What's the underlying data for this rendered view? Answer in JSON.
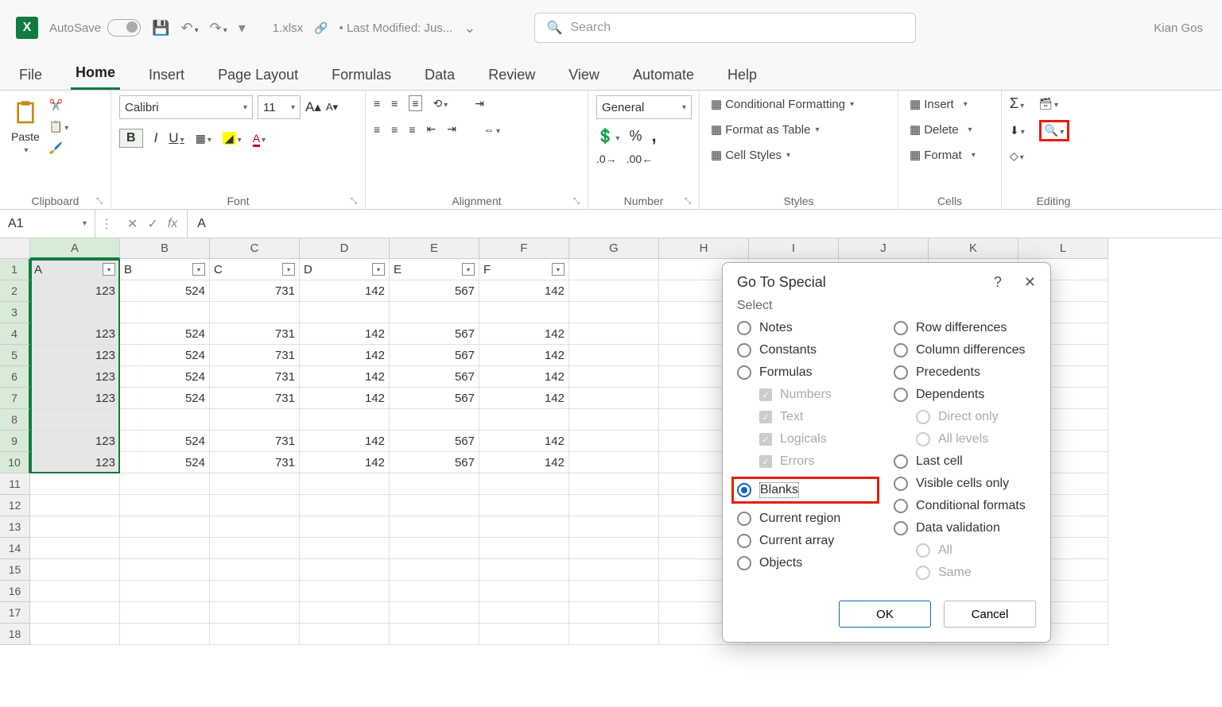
{
  "titlebar": {
    "autosave_label": "AutoSave",
    "autosave_state": "Off",
    "filename": "1.xlsx",
    "modified": "• Last Modified: Jus...",
    "search_placeholder": "Search",
    "username": "Kian Gos"
  },
  "tabs": [
    "File",
    "Home",
    "Insert",
    "Page Layout",
    "Formulas",
    "Data",
    "Review",
    "View",
    "Automate",
    "Help"
  ],
  "active_tab": "Home",
  "ribbon": {
    "clipboard": {
      "paste": "Paste",
      "label": "Clipboard"
    },
    "font": {
      "name": "Calibri",
      "size": "11",
      "label": "Font"
    },
    "alignment": {
      "label": "Alignment"
    },
    "number": {
      "format": "General",
      "label": "Number"
    },
    "styles": {
      "conditional": "Conditional Formatting",
      "table": "Format as Table",
      "cell": "Cell Styles",
      "label": "Styles"
    },
    "cells": {
      "insert": "Insert",
      "delete": "Delete",
      "format": "Format",
      "label": "Cells"
    },
    "editing": {
      "label": "Editing"
    }
  },
  "formula_bar": {
    "name_box": "A1",
    "value": "A"
  },
  "grid": {
    "columns": [
      "A",
      "B",
      "C",
      "D",
      "E",
      "F",
      "G",
      "H",
      "I",
      "J",
      "K",
      "L"
    ],
    "selected_col": "A",
    "headers": [
      "A",
      "B",
      "C",
      "D",
      "E",
      "F"
    ],
    "rows": [
      {
        "n": 1,
        "cells": [
          "A",
          "B",
          "C",
          "D",
          "E",
          "F"
        ],
        "is_header": true
      },
      {
        "n": 2,
        "cells": [
          "123",
          "524",
          "731",
          "142",
          "567",
          "142"
        ]
      },
      {
        "n": 3,
        "cells": [
          "",
          "",
          "",
          "",
          "",
          ""
        ]
      },
      {
        "n": 4,
        "cells": [
          "123",
          "524",
          "731",
          "142",
          "567",
          "142"
        ]
      },
      {
        "n": 5,
        "cells": [
          "123",
          "524",
          "731",
          "142",
          "567",
          "142"
        ]
      },
      {
        "n": 6,
        "cells": [
          "123",
          "524",
          "731",
          "142",
          "567",
          "142"
        ]
      },
      {
        "n": 7,
        "cells": [
          "123",
          "524",
          "731",
          "142",
          "567",
          "142"
        ]
      },
      {
        "n": 8,
        "cells": [
          "",
          "",
          "",
          "",
          "",
          ""
        ]
      },
      {
        "n": 9,
        "cells": [
          "123",
          "524",
          "731",
          "142",
          "567",
          "142"
        ]
      },
      {
        "n": 10,
        "cells": [
          "123",
          "524",
          "731",
          "142",
          "567",
          "142"
        ]
      },
      {
        "n": 11,
        "cells": [
          "",
          "",
          "",
          "",
          "",
          ""
        ]
      },
      {
        "n": 12,
        "cells": [
          "",
          "",
          "",
          "",
          "",
          ""
        ]
      },
      {
        "n": 13,
        "cells": [
          "",
          "",
          "",
          "",
          "",
          ""
        ]
      },
      {
        "n": 14,
        "cells": [
          "",
          "",
          "",
          "",
          "",
          ""
        ]
      },
      {
        "n": 15,
        "cells": [
          "",
          "",
          "",
          "",
          "",
          ""
        ]
      },
      {
        "n": 16,
        "cells": [
          "",
          "",
          "",
          "",
          "",
          ""
        ]
      },
      {
        "n": 17,
        "cells": [
          "",
          "",
          "",
          "",
          "",
          ""
        ]
      },
      {
        "n": 18,
        "cells": [
          "",
          "",
          "",
          "",
          "",
          ""
        ]
      }
    ]
  },
  "dialog": {
    "title": "Go To Special",
    "select_label": "Select",
    "left_options": [
      {
        "label": "Notes",
        "ul": "N"
      },
      {
        "label": "Constants",
        "ul": "o"
      },
      {
        "label": "Formulas",
        "ul": "F"
      }
    ],
    "formula_checks": [
      "Numbers",
      "Text",
      "Logicals",
      "Errors"
    ],
    "left_options2": [
      {
        "label": "Blanks",
        "ul": "k",
        "selected": true
      },
      {
        "label": "Current region",
        "ul": "r"
      },
      {
        "label": "Current array",
        "ul": "a"
      },
      {
        "label": "Objects",
        "ul": "b"
      }
    ],
    "right_options": [
      {
        "label": "Row differences",
        "ul": "w"
      },
      {
        "label": "Column differences",
        "ul": "m"
      },
      {
        "label": "Precedents",
        "ul": "P"
      },
      {
        "label": "Dependents",
        "ul": "D"
      }
    ],
    "dep_subs": [
      "Direct only",
      "All levels"
    ],
    "right_options2": [
      {
        "label": "Last cell",
        "ul": "s"
      },
      {
        "label": "Visible cells only",
        "ul": "y"
      },
      {
        "label": "Conditional formats",
        "ul": "t"
      },
      {
        "label": "Data validation",
        "ul": "v"
      }
    ],
    "val_subs": [
      "All",
      "Same"
    ],
    "ok": "OK",
    "cancel": "Cancel"
  }
}
